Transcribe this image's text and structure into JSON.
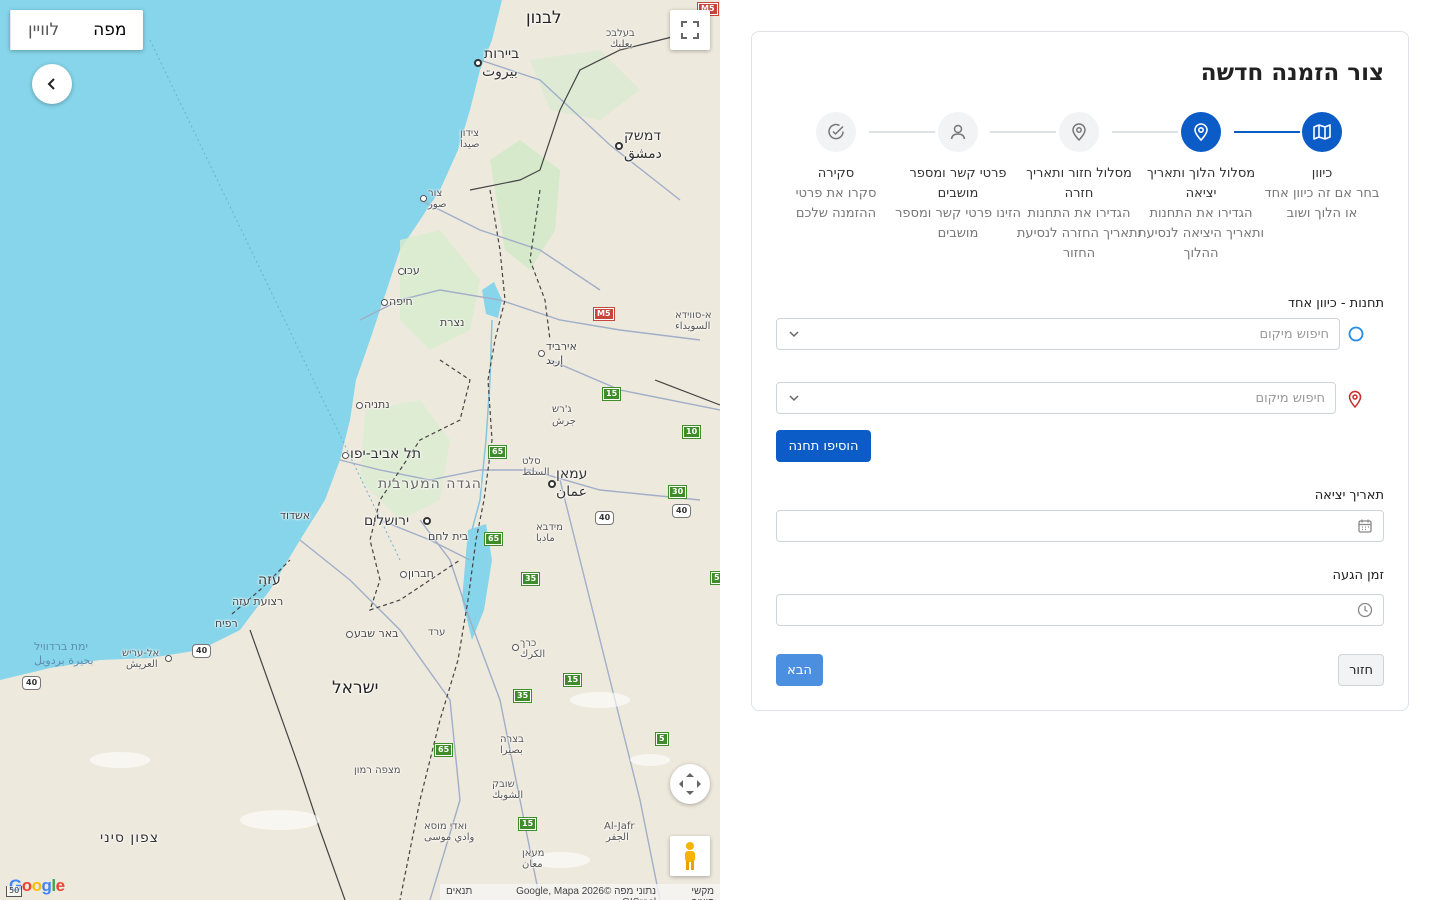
{
  "map": {
    "type_tabs": {
      "map": "מפה",
      "satellite": "לוויין"
    },
    "labels": {
      "lebanon": "לבנון",
      "beirut_he": "ביירות",
      "beirut_ar": "بيروت",
      "damascus_he": "דמשק",
      "damascus_ar": "دمشق",
      "sidon_he": "צידון",
      "sidon_ar": "صيدا",
      "tyre_he": "צור",
      "tyre_ar": "صور",
      "baalbek_he": "בעלבכ",
      "baalbek_ar": "بعلبك",
      "acre": "עכו",
      "haifa": "חיפה",
      "nazareth": "נצרת",
      "irbid_he": "אירביד",
      "irbid_ar": "إربد",
      "suwayda_he": "א-סווידא",
      "suwayda_ar": "السويداء",
      "netanya": "נתניה",
      "tel_aviv": "תל אביב-יפו",
      "west_bank": "הגדה המערבית",
      "jerash_he": "ג'רש",
      "jerash_ar": "جرش",
      "salt_he": "סלט",
      "salt_ar": "السلط",
      "amman_he": "עמאן",
      "amman_ar": "عمان",
      "ashdod": "אשדוד",
      "jerusalem": "ירושלים",
      "bethlehem": "בית לחם",
      "madaba_he": "מידבא",
      "madaba_ar": "مادبا",
      "gaza_he": "עזה",
      "gaza_ar": "غزة",
      "gaza_strip": "רצועת עזה",
      "hebron": "חברון",
      "rafah": "רפיח",
      "beersheba": "באר שבע",
      "arad": "ערד",
      "karak_he": "כרך",
      "karak_ar": "الكرك",
      "bardawil_he": "ימת ברדוויל",
      "bardawil_ar": "بحيرة بردويل",
      "arish_he": "אל-עריש",
      "arish_ar": "العريش",
      "israel": "ישראל",
      "bozra_he": "בצרה",
      "bozra_ar": "بصيرا",
      "mitzpe_ramon": "מצפה רמון",
      "shobak_he": "שובק",
      "shobak_ar": "الشوبك",
      "north_sinai": "צפון סיני",
      "wadi_musa_he": "ואדי מוסא",
      "wadi_musa_ar": "وادي موسى",
      "al_jafr_en": "Al-Jafr",
      "al_jafr_ar": "الجفر",
      "maan_he": "מעאן",
      "maan_ar": "معان"
    },
    "shields": [
      "M5",
      "M5",
      "15",
      "10",
      "65",
      "30",
      "40",
      "40",
      "65",
      "35",
      "5",
      "40",
      "15",
      "35",
      "65",
      "5",
      "15",
      "40"
    ],
    "google_logo": "Google",
    "attribution": {
      "shortcuts": "מקשי קיצור",
      "data": "נתוני מפה ©2026 Google, Mapa GISrael",
      "terms": "תנאים"
    },
    "scale": "50"
  },
  "form": {
    "title": "צור הזמנה חדשה",
    "steps": [
      {
        "title": "כיוון",
        "desc": "בחר אם זה כיוון אחד או הלוך ושוב",
        "icon": "map-icon",
        "active": true
      },
      {
        "title": "מסלול הלוך ותאריך יציאה",
        "desc": "הגדירו את התחנות ותאריך היציאה לנסיעת ההלוך",
        "icon": "map-pin-icon",
        "active": true
      },
      {
        "title": "מסלול חזור ותאריך חזרה",
        "desc": "הגדירו את התחנות ותאריך החזרה לנסיעת החזור",
        "icon": "map-pin-icon",
        "active": false
      },
      {
        "title": "פרטי קשר ומספר מושבים",
        "desc": "הזינו פרטי קשר ומספר מושבים",
        "icon": "user-icon",
        "active": false
      },
      {
        "title": "סקירה",
        "desc": "סקרו את פרטי ההזמנה שלכם",
        "icon": "check-circle-icon",
        "active": false
      }
    ],
    "stations_label": "תחנות - כיוון אחד",
    "origin_placeholder": "חיפוש מיקום",
    "destination_placeholder": "חיפוש מיקום",
    "add_station": "הוסיפו תחנה",
    "departure_date_label": "תאריך יציאה",
    "departure_date_value": "",
    "arrival_time_label": "זמן הגעה",
    "arrival_time_value": "",
    "back_button": "חזור",
    "next_button": "הבא",
    "colors": {
      "primary": "#0b5cc7",
      "next_disabled": "#4a8fe0",
      "origin_circle": "#228be6",
      "destination_pin": "#c92a2a"
    }
  }
}
